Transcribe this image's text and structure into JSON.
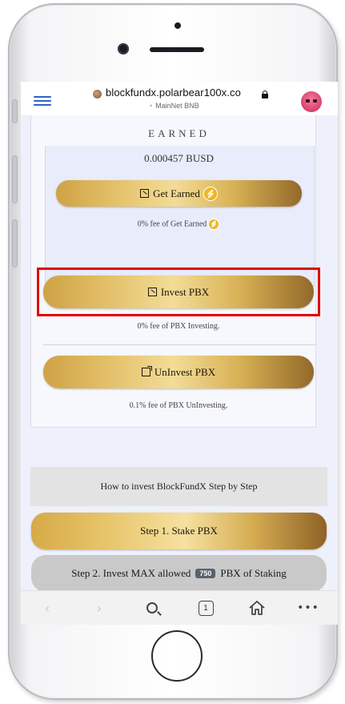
{
  "browser": {
    "url_host": "blockfundx.polarbear100x.co",
    "network_label": "MainNet BNB"
  },
  "earned": {
    "title": "EARNED",
    "value": "0.000457 BUSD",
    "get_button": "Get Earned",
    "fee": "0% fee of Get Earned"
  },
  "invest": {
    "button": "Invest PBX",
    "fee": "0% fee of PBX Investing."
  },
  "uninvest": {
    "button": "UnInvest PBX",
    "fee": "0.1% fee of PBX UnInvesting."
  },
  "steps": {
    "how_to": "How to invest BlockFundX Step by Step",
    "step1": "Step 1. Stake PBX",
    "step2_prefix": "Step 2. Invest MAX allowed",
    "step2_badge": "750",
    "step2_suffix": "PBX of Staking"
  },
  "toolbar": {
    "back": "‹",
    "forward": "›",
    "tab_count": "1",
    "more": "•••"
  },
  "colors": {
    "gold_light": "#f3dc97",
    "gold_dark": "#93692a",
    "highlight_red": "#e20000",
    "link_blue": "#2b63c6"
  },
  "icons": [
    "hamburger-menu-icon",
    "site-favicon-icon",
    "lock-icon",
    "avatar",
    "invest-icon",
    "coin-icon",
    "external-link-icon",
    "search-icon",
    "tabs-icon",
    "home-icon",
    "more-icon"
  ]
}
